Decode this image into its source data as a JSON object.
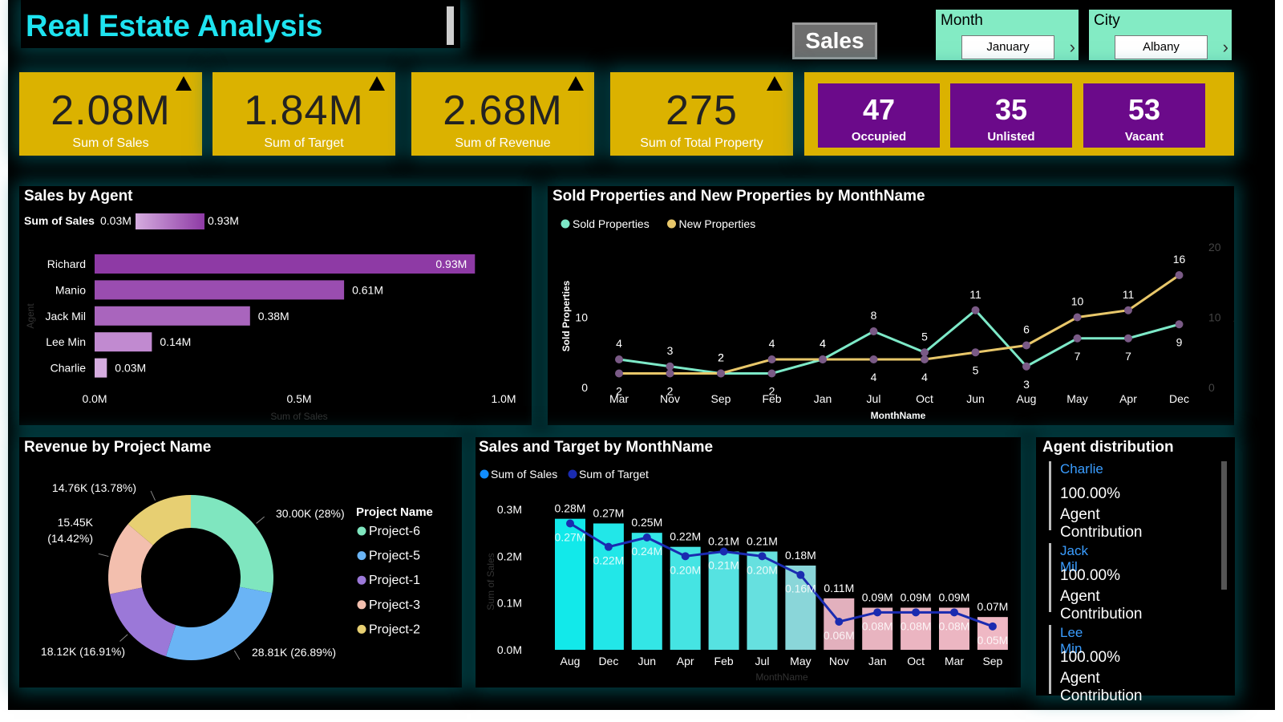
{
  "title": "Real Estate Analysis",
  "sales_button": "Sales",
  "filters": [
    {
      "label": "Month",
      "value": "January"
    },
    {
      "label": "City",
      "value": "Albany"
    }
  ],
  "kpis": [
    {
      "value": "2.08M",
      "caption": "Sum of Sales"
    },
    {
      "value": "1.84M",
      "caption": "Sum of Target"
    },
    {
      "value": "2.68M",
      "caption": "Sum of Revenue"
    },
    {
      "value": "275",
      "caption": "Sum of Total Property"
    }
  ],
  "occupancy": [
    {
      "value": "47",
      "caption": "Occupied"
    },
    {
      "value": "35",
      "caption": "Unlisted"
    },
    {
      "value": "53",
      "caption": "Vacant"
    }
  ],
  "agent_panel": {
    "title": "Agent distribution",
    "agents": [
      {
        "name": "Charlie",
        "pct": "100.00%",
        "label": "Agent Contribution"
      },
      {
        "name": "Jack Mil",
        "pct": "100.00%",
        "label": "Agent Contribution"
      },
      {
        "name": "Lee Min",
        "pct": "100.00%",
        "label": "Agent Contribution"
      }
    ]
  },
  "chart_data": [
    {
      "id": "sales_by_agent",
      "type": "bar",
      "orientation": "horizontal",
      "title": "Sales by Agent",
      "legend_title": "Sum of Sales",
      "legend_min": "0.03M",
      "legend_max": "0.93M",
      "categories": [
        "Richard",
        "Manio",
        "Jack Mil",
        "Lee Min",
        "Charlie"
      ],
      "values": [
        0.93,
        0.61,
        0.38,
        0.14,
        0.03
      ],
      "labels": [
        "0.93M",
        "0.61M",
        "0.38M",
        "0.14M",
        "0.03M"
      ],
      "colors": [
        "#8e3aa5",
        "#9a4db0",
        "#a965bd",
        "#c18ad0",
        "#d5acdf"
      ],
      "xlabel": "Sum of Sales",
      "ylabel": "Agent",
      "xlim": [
        0,
        1.0
      ],
      "xticks": [
        "0.0M",
        "0.5M",
        "1.0M"
      ]
    },
    {
      "id": "sold_new_props",
      "type": "line",
      "title": "Sold Properties and New Properties by MonthName",
      "x": [
        "Mar",
        "Nov",
        "Sep",
        "Feb",
        "Jan",
        "Jul",
        "Oct",
        "Jun",
        "Aug",
        "May",
        "Apr",
        "Dec"
      ],
      "series": [
        {
          "name": "Sold Properties",
          "color": "#7de9c8",
          "values": [
            4,
            3,
            2,
            2,
            4,
            8,
            5,
            11,
            3,
            7,
            7,
            9
          ]
        },
        {
          "name": "New Properties",
          "color": "#e8c76a",
          "values": [
            2,
            2,
            2,
            4,
            4,
            4,
            4,
            5,
            6,
            10,
            11,
            16
          ]
        }
      ],
      "xlabel": "MonthName",
      "ylabel": "Sold Properties",
      "y2label": "New Properties",
      "ylim": [
        0,
        20
      ],
      "y2lim": [
        0,
        20
      ],
      "y_ticks": [
        "0",
        "10"
      ],
      "y2_ticks": [
        "0",
        "10",
        "20"
      ]
    },
    {
      "id": "revenue_by_project",
      "type": "pie",
      "donut": true,
      "title": "Revenue by Project Name",
      "legend_title": "Project Name",
      "categories": [
        "Project-6",
        "Project-5",
        "Project-1",
        "Project-3",
        "Project-2"
      ],
      "values": [
        30.0,
        28.81,
        18.12,
        15.45,
        14.76
      ],
      "labels": [
        "30.00K (28%)",
        "28.81K (26.89%)",
        "18.12K (16.91%)",
        "15.45K (14.42%)",
        "14.76K (13.78%)"
      ],
      "colors": [
        "#7fe6bf",
        "#6ab4f5",
        "#9b78d8",
        "#f3bfae",
        "#e7cf72"
      ]
    },
    {
      "id": "sales_target",
      "type": "bar",
      "title": "Sales and Target by MonthName",
      "categories": [
        "Aug",
        "Dec",
        "Jun",
        "Apr",
        "Feb",
        "Jul",
        "May",
        "Nov",
        "Jan",
        "Oct",
        "Mar",
        "Sep"
      ],
      "series": [
        {
          "name": "Sum of Sales",
          "color": "#118dff",
          "values": [
            0.28,
            0.27,
            0.25,
            0.22,
            0.21,
            0.21,
            0.18,
            0.11,
            0.09,
            0.09,
            0.09,
            0.07
          ],
          "labels": [
            "0.28M",
            "0.27M",
            "0.25M",
            "0.22M",
            "0.21M",
            "0.21M",
            "0.18M",
            "0.11M",
            "0.09M",
            "0.09M",
            "0.09M",
            "0.07M"
          ]
        },
        {
          "name": "Sum of Target",
          "color": "#1a2bb0",
          "values": [
            0.27,
            0.22,
            0.24,
            0.2,
            0.21,
            0.2,
            0.16,
            0.06,
            0.08,
            0.08,
            0.08,
            0.05
          ],
          "labels": [
            "0.27M",
            "0.22M",
            "0.24M",
            "0.20M",
            "0.21M",
            "0.20M",
            "0.16M",
            "0.06M",
            "0.08M",
            "0.08M",
            "0.08M",
            "0.05M"
          ]
        }
      ],
      "bar_colors": [
        "#12e9ea",
        "#22e7e8",
        "#33e6e6",
        "#45e4e3",
        "#56e2e1",
        "#66e0df",
        "#8ad6d9",
        "#e2b0bd",
        "#e8b4c0",
        "#ebb5c1",
        "#ecb6c2",
        "#efb8c4"
      ],
      "xlabel": "MonthName",
      "ylabel": "Sum of Sales",
      "ylim": [
        0,
        0.3
      ],
      "yticks": [
        "0.0M",
        "0.1M",
        "0.2M",
        "0.3M"
      ]
    }
  ]
}
